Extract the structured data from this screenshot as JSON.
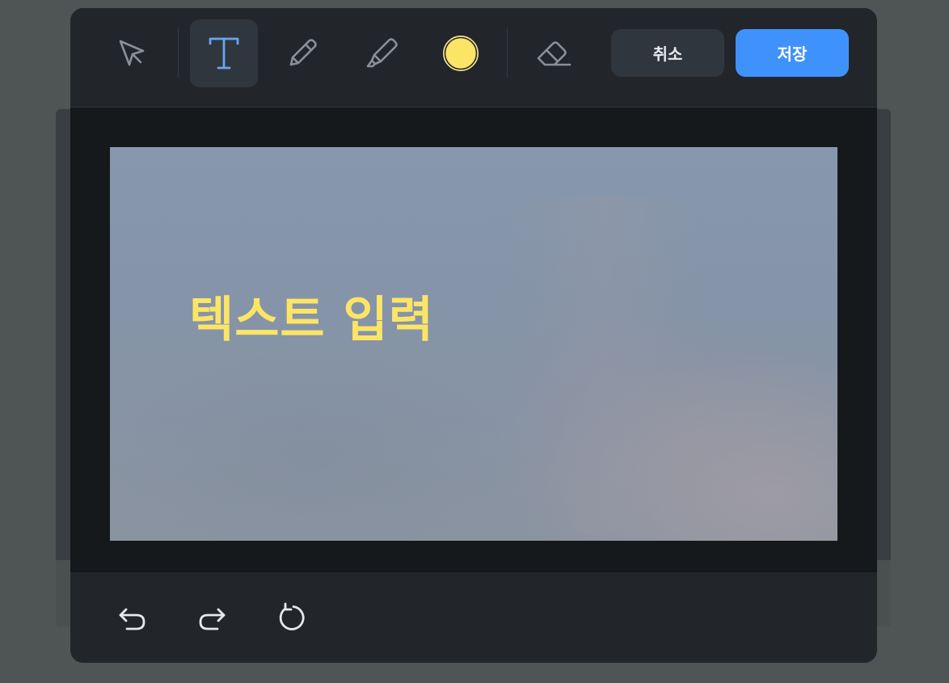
{
  "toolbar": {
    "tools": [
      {
        "name": "select",
        "icon": "cursor-icon",
        "active": false
      },
      {
        "name": "text",
        "icon": "text-icon",
        "active": true
      },
      {
        "name": "pencil",
        "icon": "pencil-icon",
        "active": false
      },
      {
        "name": "highlighter",
        "icon": "highlighter-icon",
        "active": false
      },
      {
        "name": "color",
        "icon": "color-swatch-icon",
        "active": false
      },
      {
        "name": "eraser",
        "icon": "eraser-icon",
        "active": false
      }
    ],
    "cancel_label": "취소",
    "save_label": "저장"
  },
  "canvas": {
    "text_annotation": "텍스트 입력"
  },
  "history": {
    "undo_icon": "undo-icon",
    "redo_icon": "redo-icon",
    "reset_icon": "reset-icon"
  },
  "colors": {
    "accent": "#3f92fb",
    "active_tool": "#68a6ef",
    "selected_color": "#fce566",
    "icon_gray": "#8a9099"
  }
}
